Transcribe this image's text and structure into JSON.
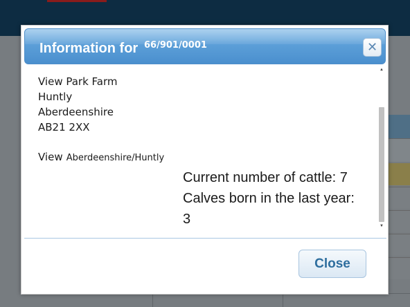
{
  "dialog": {
    "title_prefix": "Information for",
    "record_id": "66/901/0001",
    "close_icon": "close-icon",
    "address_lines": [
      "View Park Farm",
      "Huntly",
      "Aberdeenshire",
      "AB21 2XX"
    ],
    "view_word": "View",
    "view_location": "Aberdeenshire/Huntly",
    "stats": {
      "cattle_line": "Current number of cattle: 7",
      "calves_label": "Calves born in the last year:",
      "calves_value": "3"
    },
    "close_button_label": "Close",
    "scrollbar": {
      "up_icon": "scroll-up-arrow-icon",
      "down_icon": "scroll-down-arrow-icon"
    }
  },
  "colors": {
    "titlebar": "#5c9fd8",
    "header_background": "#0d2c42",
    "close_text": "#2e6e9e"
  }
}
